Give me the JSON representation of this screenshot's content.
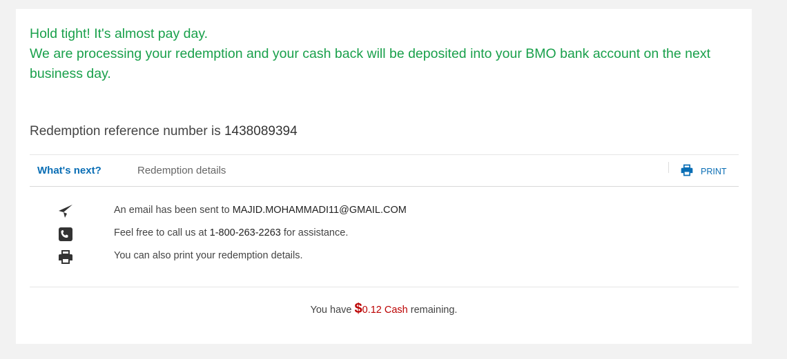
{
  "message": {
    "line1": "Hold tight! It's almost pay day.",
    "line2": "We are processing your redemption and your cash back will be deposited into your BMO bank account on the next business day."
  },
  "reference": {
    "prefix": "Redemption reference number is ",
    "number": "1438089394"
  },
  "tabs": {
    "active": "What's next?",
    "details": "Redemption details",
    "print": "PRINT"
  },
  "items": {
    "email": {
      "prefix": "An email has been sent to ",
      "value": "MAJID.MOHAMMADI11@GMAIL.COM"
    },
    "phone": {
      "prefix": "Feel free to call us at ",
      "value": "1-800-263-2263",
      "suffix": " for assistance."
    },
    "print": {
      "text": "You can also print your redemption details."
    }
  },
  "remaining": {
    "prefix": "You have ",
    "dollar": "$",
    "amount": "0.12 Cash",
    "suffix": " remaining."
  },
  "colors": {
    "success": "#19a04b",
    "link": "#0a6eb5",
    "cash": "#bb0000"
  },
  "icons": [
    "paper-plane-icon",
    "phone-icon",
    "printer-icon"
  ]
}
